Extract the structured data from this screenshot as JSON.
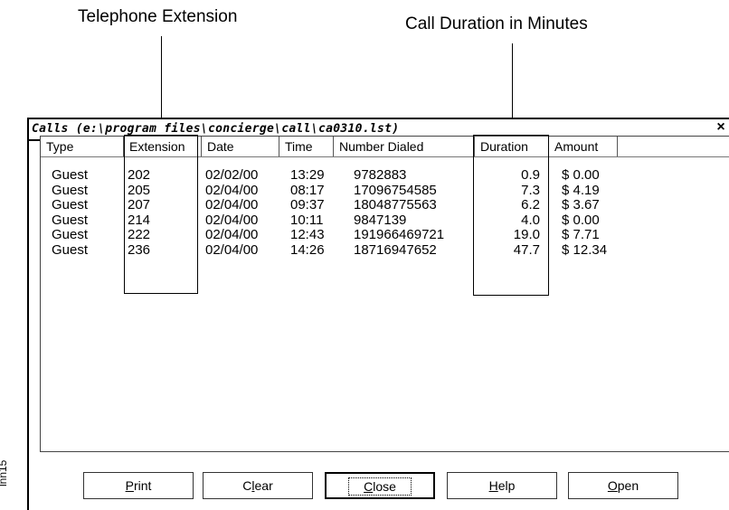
{
  "annotations": {
    "telephone_extension": "Telephone Extension",
    "call_duration": "Call Duration in Minutes",
    "figure_code": "lnn15"
  },
  "window": {
    "title": "Calls (e:\\program files\\concierge\\call\\ca0310.lst)",
    "close_glyph": "×"
  },
  "table": {
    "columns": [
      "Type",
      "Extension",
      "Date",
      "Time",
      "Number Dialed",
      "Duration",
      "Amount"
    ],
    "rows": [
      [
        "Guest",
        "202",
        "02/02/00",
        "13:29",
        "9782883",
        "0.9",
        "$ 0.00"
      ],
      [
        "Guest",
        "205",
        "02/04/00",
        "08:17",
        "17096754585",
        "7.3",
        "$ 4.19"
      ],
      [
        "Guest",
        "207",
        "02/04/00",
        "09:37",
        "18048775563",
        "6.2",
        "$ 3.67"
      ],
      [
        "Guest",
        "214",
        "02/04/00",
        "10:11",
        "9847139",
        "4.0",
        "$ 0.00"
      ],
      [
        "Guest",
        "222",
        "02/04/00",
        "12:43",
        "191966469721",
        "19.0",
        "$ 7.71"
      ],
      [
        "Guest",
        "236",
        "02/04/00",
        "14:26",
        "18716947652",
        "47.7",
        "$ 12.34"
      ]
    ]
  },
  "buttons": {
    "print": {
      "mnemonic": "P",
      "rest": "rint"
    },
    "clear": {
      "pre": "C",
      "mnemonic": "l",
      "rest": "ear"
    },
    "close": {
      "mnemonic": "C",
      "rest": "lose"
    },
    "help": {
      "mnemonic": "H",
      "rest": "elp"
    },
    "open": {
      "mnemonic": "O",
      "rest": "pen"
    }
  }
}
